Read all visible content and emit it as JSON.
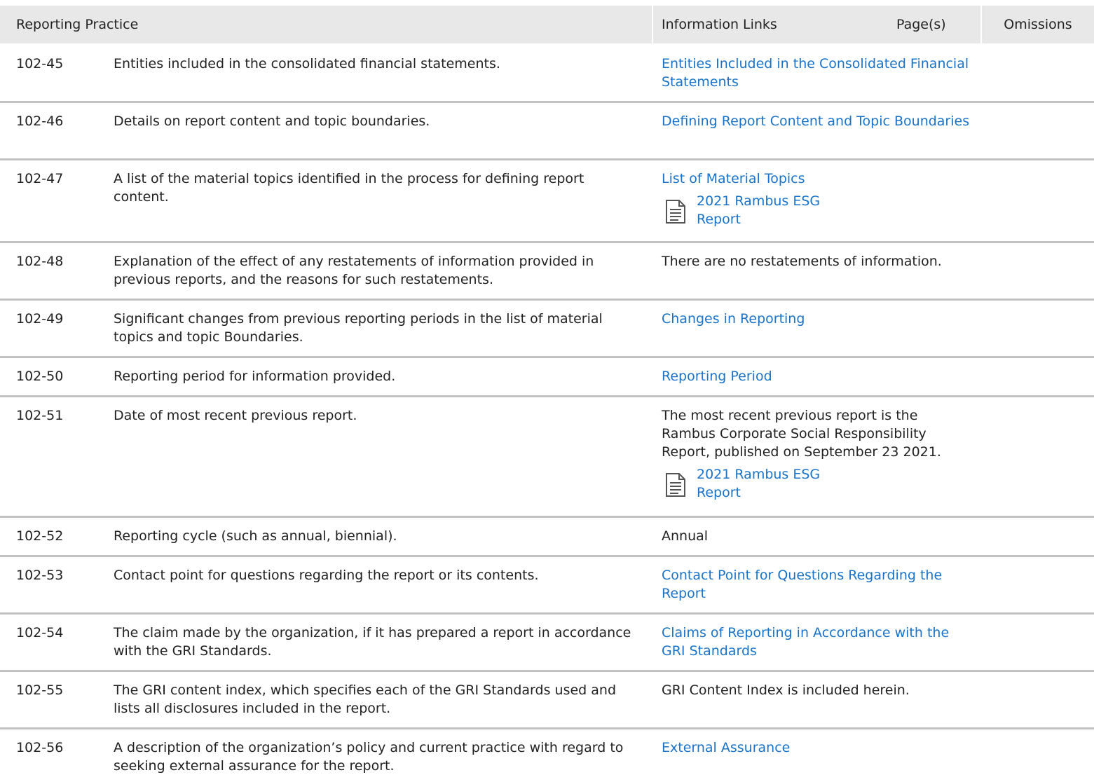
{
  "header": {
    "reporting_practice": "Reporting Practice",
    "information_links": "Information Links",
    "pages": "Page(s)",
    "omissions": "Omissions"
  },
  "rows": [
    {
      "code": "102-45",
      "description": "Entities included in the consolidated financial statements.",
      "links": [
        "Entities Included in the Consolidated Financial Statements"
      ]
    },
    {
      "code": "102-46",
      "description": "Details on report content and topic boundaries.",
      "links": [
        "Defining Report Content and Topic Boundaries"
      ]
    },
    {
      "code": "102-47",
      "description": "A list of the material topics identified in the process for defining report content.",
      "links": [
        "List of Material Topics"
      ],
      "doc": "2021 Rambus ESG Report"
    },
    {
      "code": "102-48",
      "description": "Explanation of the effect of any restatements of information provided in previous reports, and the reasons for such restatements.",
      "text": "There are no restatements of information."
    },
    {
      "code": "102-49",
      "description": "Significant changes from previous reporting periods in the list of material topics and topic Boundaries.",
      "links": [
        "Changes in Reporting"
      ]
    },
    {
      "code": "102-50",
      "description": "Reporting period for information provided.",
      "links": [
        "Reporting Period"
      ]
    },
    {
      "code": "102-51",
      "description": "Date of most recent previous report.",
      "text": "The most recent previous report is the Rambus Corporate Social Responsibility Report, published on September 23 2021.",
      "doc": "2021 Rambus ESG Report"
    },
    {
      "code": "102-52",
      "description": "Reporting cycle (such as annual, biennial).",
      "text": "Annual"
    },
    {
      "code": "102-53",
      "description": "Contact point for questions regarding the report or its contents.",
      "links": [
        "Contact Point for Questions Regarding the Report"
      ]
    },
    {
      "code": "102-54",
      "description": "The claim made by the organization, if it has prepared a report in accordance with the GRI Standards.",
      "links": [
        "Claims of Reporting in Accordance with the GRI Standards"
      ]
    },
    {
      "code": "102-55",
      "description": "The GRI content index, which specifies each of the GRI Standards used and lists all disclosures included in the report.",
      "text": "GRI Content Index is included herein."
    },
    {
      "code": "102-56",
      "description": "A description of the organization’s policy and current practice with regard to seeking external assurance for the report.",
      "links": [
        "External Assurance"
      ]
    }
  ],
  "colors": {
    "link": "#1a73c8",
    "header_bg": "#e8e8e8",
    "divider": "#c2c2c2",
    "text": "#222222"
  },
  "icons": {
    "document": "document-icon"
  }
}
